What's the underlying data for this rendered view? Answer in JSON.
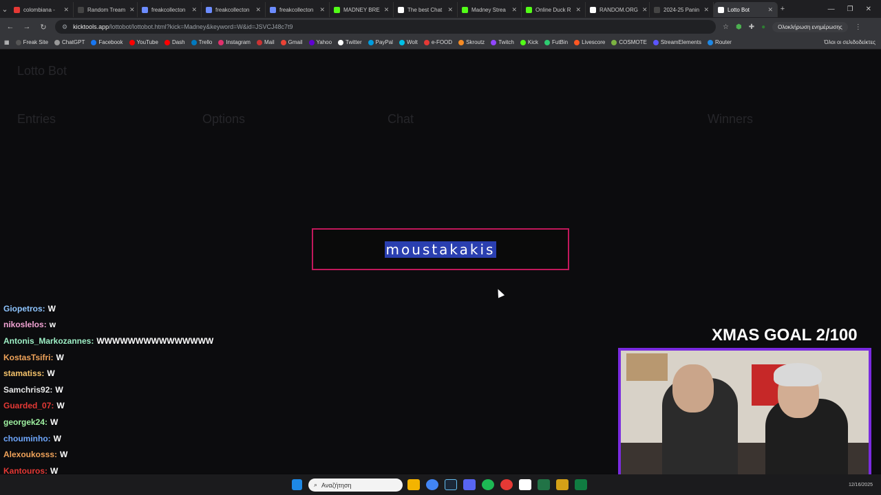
{
  "tabs": [
    {
      "label": "colombiana - ",
      "color": "#e53935"
    },
    {
      "label": "Random Tream",
      "color": "#444"
    },
    {
      "label": "freakcollecton",
      "color": "#6c8cff"
    },
    {
      "label": "freakcollecton",
      "color": "#6c8cff"
    },
    {
      "label": "freakcollecton",
      "color": "#6c8cff"
    },
    {
      "label": "MADNEY BRE",
      "color": "#53fc18"
    },
    {
      "label": "The best Chat",
      "color": "#ffffff"
    },
    {
      "label": "Madney Strea",
      "color": "#53fc18"
    },
    {
      "label": "Online Duck R",
      "color": "#53fc18"
    },
    {
      "label": "RANDOM.ORG",
      "color": "#ffffff"
    },
    {
      "label": "2024-25 Panin",
      "color": "#444"
    },
    {
      "label": "Lotto Bot",
      "color": "#ffffff",
      "active": true
    }
  ],
  "address": {
    "host": "kicktools.app",
    "path": "/lottobot/lottobot.html?kick=Madney&keyword=W&id=JSVCJ48c7t9",
    "update_label": "Ολοκλήρωση ενημέρωσης"
  },
  "bookmarks": [
    {
      "label": "Freak Site",
      "color": "#555"
    },
    {
      "label": "ChatGPT",
      "color": "#999"
    },
    {
      "label": "Facebook",
      "color": "#1877f2"
    },
    {
      "label": "YouTube",
      "color": "#ff0000"
    },
    {
      "label": "Dash",
      "color": "#ff0000"
    },
    {
      "label": "Trello",
      "color": "#0079bf"
    },
    {
      "label": "Instagram",
      "color": "#e1306c"
    },
    {
      "label": "Mail",
      "color": "#cc3333"
    },
    {
      "label": "Gmail",
      "color": "#ea4335"
    },
    {
      "label": "Yahoo",
      "color": "#6001d2"
    },
    {
      "label": "Twitter",
      "color": "#ffffff"
    },
    {
      "label": "PayPal",
      "color": "#009cde"
    },
    {
      "label": "Wolt",
      "color": "#00c2e8"
    },
    {
      "label": "e-FOOD",
      "color": "#e53935"
    },
    {
      "label": "Skroutz",
      "color": "#f68b24"
    },
    {
      "label": "Twitch",
      "color": "#9146ff"
    },
    {
      "label": "Kick",
      "color": "#53fc18"
    },
    {
      "label": "FutBin",
      "color": "#2ecc71"
    },
    {
      "label": "Livescore",
      "color": "#ff5722"
    },
    {
      "label": "COSMOTE",
      "color": "#7cb342"
    },
    {
      "label": "StreamElements",
      "color": "#5b55ff"
    },
    {
      "label": "Router",
      "color": "#1e88e5"
    }
  ],
  "bookmarks_all": "Όλοι οι σελιδοδείκτες",
  "background_panels": {
    "app_title": "Lotto Bot",
    "entries": "Entries",
    "options": "Options",
    "chat": "Chat",
    "winners": "Winners"
  },
  "winner_modal": {
    "name": "moustakakis",
    "border_color": "#c2185b"
  },
  "chat_overlay": [
    {
      "user": "Giopetros:",
      "msg": "W",
      "color": "#8ec5ff"
    },
    {
      "user": "nikoslelos:",
      "msg": "w",
      "color": "#f2a3d4"
    },
    {
      "user": "Antonis_Markozannes:",
      "msg": "WWWWWWWWWWWWWWW",
      "color": "#9ef0c6"
    },
    {
      "user": "KostasTsifri:",
      "msg": "W",
      "color": "#f0a35a"
    },
    {
      "user": "stamatiss:",
      "msg": "W",
      "color": "#f5c36b"
    },
    {
      "user": "Samchris92:",
      "msg": "W",
      "color": "#e8e8e8"
    },
    {
      "user": "Guarded_07:",
      "msg": "W",
      "color": "#e53935"
    },
    {
      "user": "georgek24:",
      "msg": "W",
      "color": "#9ef0a0"
    },
    {
      "user": "chouminho:",
      "msg": "W",
      "color": "#6fa8ff"
    },
    {
      "user": "Alexoukosss:",
      "msg": "W",
      "color": "#f0a35a"
    },
    {
      "user": "Kantouros:",
      "msg": "W",
      "color": "#e53935"
    }
  ],
  "goal_text": "XMAS GOAL 2/100",
  "taskbar": {
    "search_placeholder": "Αναζήτηση",
    "date": "12/16/2025"
  }
}
